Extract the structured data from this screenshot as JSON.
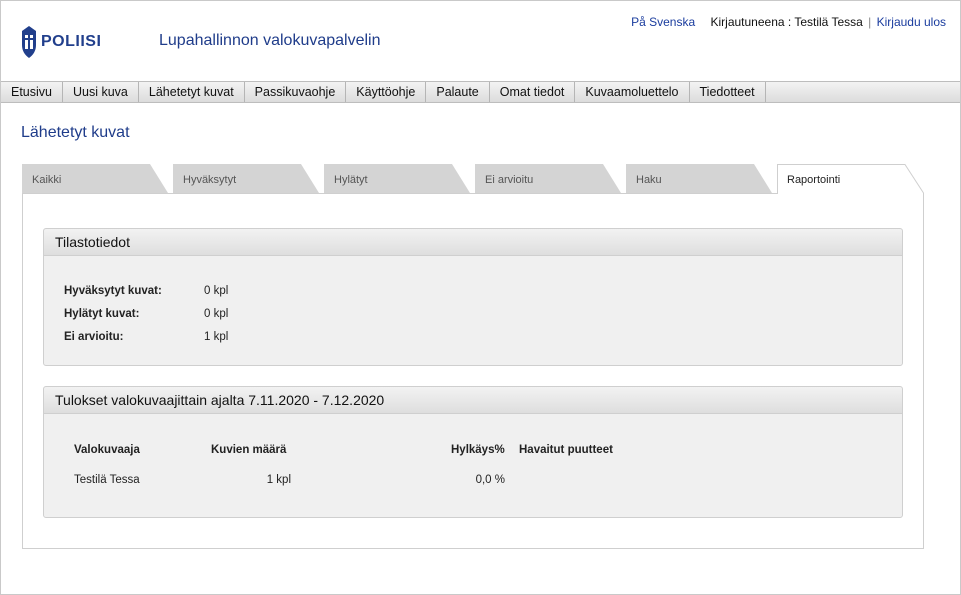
{
  "header": {
    "logo_text": "POLIISI",
    "app_title": "Lupahallinnon valokuvapalvelin",
    "language_link": "På Svenska",
    "logged_in_label": "Kirjautuneena : Testilä Tessa",
    "separator": "|",
    "logout_link": "Kirjaudu ulos"
  },
  "nav": {
    "items": [
      {
        "label": "Etusivu"
      },
      {
        "label": "Uusi kuva"
      },
      {
        "label": "Lähetetyt kuvat"
      },
      {
        "label": "Passikuvaohje"
      },
      {
        "label": "Käyttöohje"
      },
      {
        "label": "Palaute"
      },
      {
        "label": "Omat tiedot"
      },
      {
        "label": "Kuvaamoluettelo"
      },
      {
        "label": "Tiedotteet"
      }
    ]
  },
  "page": {
    "title": "Lähetetyt kuvat",
    "tabs": [
      {
        "label": "Kaikki",
        "active": false
      },
      {
        "label": "Hyväksytyt",
        "active": false
      },
      {
        "label": "Hylätyt",
        "active": false
      },
      {
        "label": "Ei arvioitu",
        "active": false
      },
      {
        "label": "Haku",
        "active": false
      },
      {
        "label": "Raportointi",
        "active": true
      }
    ]
  },
  "stats": {
    "title": "Tilastotiedot",
    "rows": [
      {
        "label": "Hyväksytyt kuvat:",
        "value": "0 kpl"
      },
      {
        "label": "Hylätyt kuvat:",
        "value": "0 kpl"
      },
      {
        "label": "Ei arvioitu:",
        "value": "1 kpl"
      }
    ]
  },
  "results": {
    "title": "Tulokset valokuvaajittain ajalta 7.11.2020 - 7.12.2020",
    "columns": {
      "photographer": "Valokuvaaja",
      "count": "Kuvien määrä",
      "rejection": "Hylkäys%",
      "defects": "Havaitut puutteet"
    },
    "rows": [
      {
        "photographer": "Testilä Tessa",
        "count": "1 kpl",
        "rejection": "0,0 %",
        "defects": ""
      }
    ]
  },
  "colors": {
    "brand_blue": "#1f3c8a",
    "link_blue": "#1a3c9e",
    "tab_inactive": "#d4d4d4",
    "panel_bg": "#f0f0f0"
  }
}
